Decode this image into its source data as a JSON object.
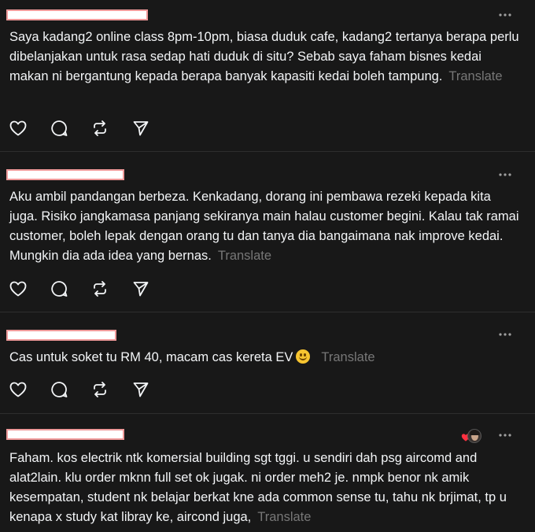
{
  "posts": [
    {
      "text": "Saya kadang2 online class 8pm-10pm, biasa duduk cafe, kadang2 tertanya berapa perlu dibelanjakan untuk rasa sedap hati duduk di situ? Sebab saya faham bisnes kedai makan ni bergantung kepada berapa banyak kapasiti kedai boleh tampung.",
      "translate": "Translate"
    },
    {
      "text": "Aku ambil pandangan berbeza. Kenkadang, dorang ini pembawa rezeki kepada kita juga. Risiko jangkamasa panjang sekiranya main halau customer begini. Kalau tak ramai customer, boleh lepak dengan orang tu dan tanya dia bangaimana nak improve kedai. Mungkin dia ada idea yang bernas.",
      "translate": "Translate"
    },
    {
      "text": "Cas untuk soket tu RM 40, macam cas kereta EV",
      "emoji": "smiling-face",
      "translate": "Translate"
    },
    {
      "text": "Faham. kos electrik ntk komersial building sgt tggi. u sendiri dah psg aircomd and alat2lain. klu order mknn full set ok jugak. ni order meh2 je. nmpk benor nk amik kesempatan, student nk belajar berkat kne ada common sense tu, tahu nk brjimat, tp u kenapa x study kat libray ke, aircond juga,",
      "translate": "Translate"
    }
  ],
  "icons": {
    "like": "heart-icon",
    "reply": "comment-icon",
    "repost": "repost-icon",
    "share": "send-icon",
    "more": "more-dots-icon"
  },
  "colors": {
    "background": "#181818",
    "text": "#f3f5f7",
    "muted": "#777777",
    "divider": "#2e2e2e",
    "redaction_border": "#ef9a9a",
    "heart": "#ff3040"
  }
}
